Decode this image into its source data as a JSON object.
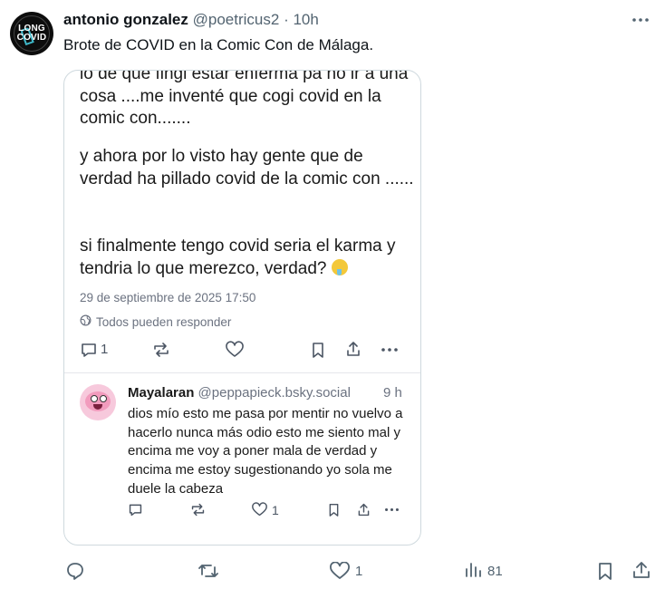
{
  "tweet": {
    "author_name": "antonio gonzalez",
    "handle": "@poetricus2",
    "separator": "·",
    "time": "10h",
    "text": "Brote de COVID en la Comic Con de Málaga.",
    "avatar": {
      "line1": "LONG",
      "line2": "COVID"
    }
  },
  "embed": {
    "paragraphs": [
      "lo de que fingi estar enferma pa no ir a una cosa ....me inventé que cogi covid en la comic con.......",
      "y ahora por lo visto hay gente que de verdad ha pillado covid de la comic con ......",
      "si finalmente tengo covid seria el karma y tendria lo que merezco, verdad?"
    ],
    "date": "29 de septiembre de 2025 17:50",
    "reply_setting": "Todos pueden responder",
    "reply_count": "1",
    "reply": {
      "name": "Mayalaran",
      "handle": "@peppapieck.bsky.social",
      "time": "9 h",
      "text": "dios mío esto me pasa por mentir no vuelvo a hacerlo nunca más odio esto me siento mal y encima me voy a poner mala de verdad y encima me estoy sugestionando yo sola me duele la cabeza",
      "like_count": "1"
    }
  },
  "actions": {
    "likes": "1",
    "views": "81"
  },
  "colors": {
    "text": "#0f1419",
    "muted": "#536471",
    "border": "#cfd9de"
  }
}
